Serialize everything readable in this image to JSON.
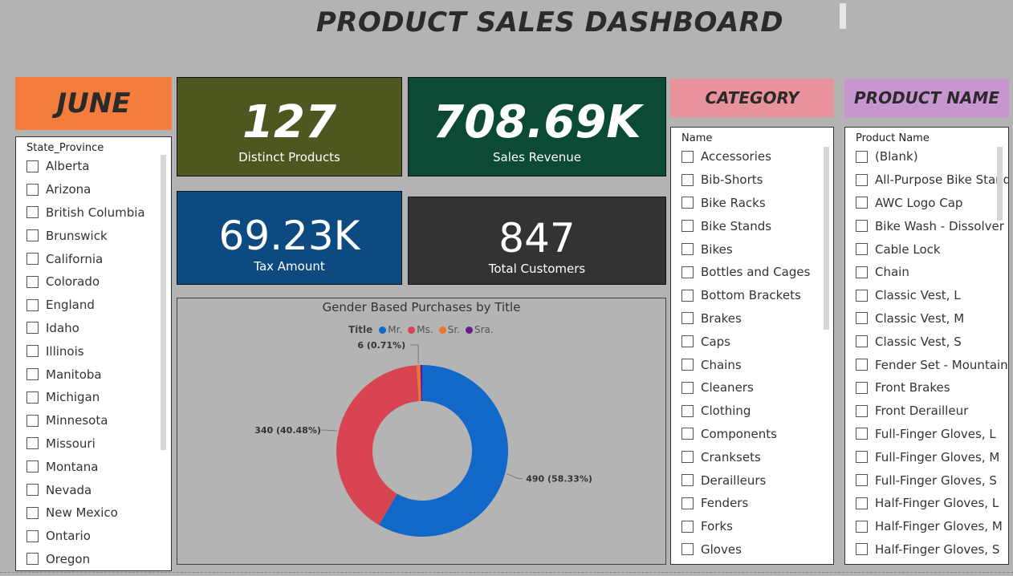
{
  "header": {
    "title": "PRODUCT SALES DASHBOARD"
  },
  "month_label": "JUNE",
  "category_label": "CATEGORY",
  "product_label": "PRODUCT NAME",
  "cards": {
    "distinct_products": {
      "value": "127",
      "label": "Distinct Products"
    },
    "sales_revenue": {
      "value": "708.69K",
      "label": "Sales Revenue"
    },
    "tax_amount": {
      "value": "69.23K",
      "label": "Tax Amount"
    },
    "total_customers": {
      "value": "847",
      "label": "Total Customers"
    }
  },
  "state_slicer": {
    "header": "State_Province",
    "items": [
      "Alberta",
      "Arizona",
      "British Columbia",
      "Brunswick",
      "California",
      "Colorado",
      "England",
      "Idaho",
      "Illinois",
      "Manitoba",
      "Michigan",
      "Minnesota",
      "Missouri",
      "Montana",
      "Nevada",
      "New Mexico",
      "Ontario",
      "Oregon"
    ]
  },
  "category_slicer": {
    "header": "Name",
    "items": [
      "Accessories",
      "Bib-Shorts",
      "Bike Racks",
      "Bike Stands",
      "Bikes",
      "Bottles and Cages",
      "Bottom Brackets",
      "Brakes",
      "Caps",
      "Chains",
      "Cleaners",
      "Clothing",
      "Components",
      "Cranksets",
      "Derailleurs",
      "Fenders",
      "Forks",
      "Gloves"
    ]
  },
  "product_slicer": {
    "header": "Product Name",
    "items": [
      "(Blank)",
      "All-Purpose Bike Stand",
      "AWC Logo Cap",
      "Bike Wash - Dissolver",
      "Cable Lock",
      "Chain",
      "Classic Vest, L",
      "Classic Vest, M",
      "Classic Vest, S",
      "Fender Set - Mountain",
      "Front Brakes",
      "Front Derailleur",
      "Full-Finger Gloves, L",
      "Full-Finger Gloves, M",
      "Full-Finger Gloves, S",
      "Half-Finger Gloves, L",
      "Half-Finger Gloves, M",
      "Half-Finger Gloves, S"
    ]
  },
  "colors": {
    "mr": "#1168c8",
    "ms": "#d94452",
    "sr": "#e8762e",
    "sra": "#6b1a8a"
  },
  "chart_data": {
    "type": "pie",
    "title": "Gender Based Purchases by Title",
    "legend_title": "Title",
    "legend_position": "top",
    "categories": [
      "Mr.",
      "Ms.",
      "Sr.",
      "Sra."
    ],
    "values": [
      490,
      340,
      6,
      3
    ],
    "data_labels": [
      {
        "category": "Mr.",
        "text": "490 (58.33%)"
      },
      {
        "category": "Ms.",
        "text": "340 (40.48%)"
      },
      {
        "category": "Sr.",
        "text": "6 (0.71%)"
      }
    ],
    "donut": true
  }
}
